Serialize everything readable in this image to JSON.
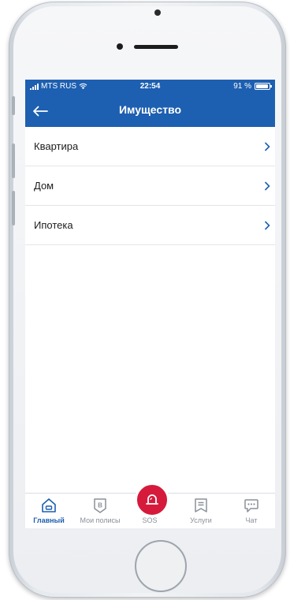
{
  "status_bar": {
    "carrier": "MTS RUS",
    "time": "22:54",
    "battery_percent": "91 %",
    "battery_level": 0.91
  },
  "header": {
    "title": "Имущество",
    "back_icon": "arrow-left-icon"
  },
  "list": {
    "items": [
      {
        "label": "Квартира"
      },
      {
        "label": "Дом"
      },
      {
        "label": "Ипотека"
      }
    ]
  },
  "tabbar": {
    "tabs": [
      {
        "label": "Главный",
        "icon": "home-icon",
        "active": true
      },
      {
        "label": "Мои полисы",
        "icon": "policy-icon",
        "active": false
      },
      {
        "label": "SOS",
        "icon": "alarm-bell-icon",
        "active": false
      },
      {
        "label": "Услуги",
        "icon": "services-icon",
        "active": false
      },
      {
        "label": "Чат",
        "icon": "chat-icon",
        "active": false
      }
    ]
  },
  "colors": {
    "brand_blue": "#1d5fb0",
    "sos_red": "#d61a3c"
  }
}
